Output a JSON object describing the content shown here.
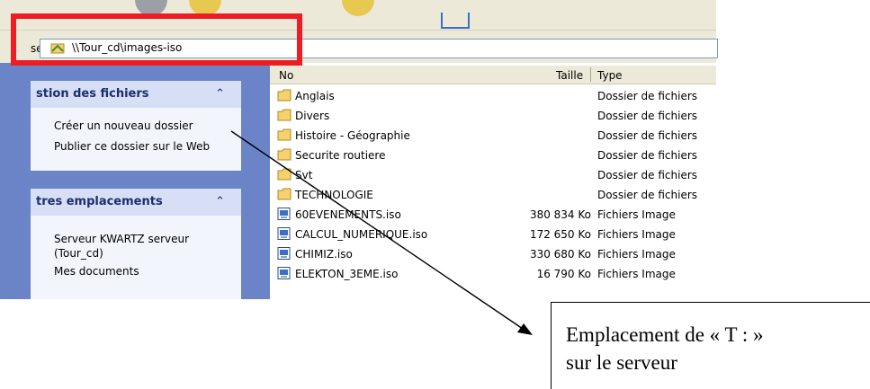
{
  "address_bar": {
    "label": "se",
    "path": "\\\\Tour_cd\\images-iso"
  },
  "sidebar": {
    "file_tasks": {
      "title": "stion des fichiers",
      "items": [
        "Créer un nouveau dossier",
        "Publier ce dossier sur le Web"
      ]
    },
    "other_places": {
      "title": "tres emplacements",
      "items": [
        "Serveur KWARTZ serveur",
        "(Tour_cd)",
        "Mes documents"
      ]
    }
  },
  "file_list": {
    "columns": {
      "name": "No",
      "size": "Taille",
      "type": "Type"
    },
    "rows": [
      {
        "name": "Anglais",
        "size": "",
        "type": "Dossier de fichiers",
        "icon": "folder-icon"
      },
      {
        "name": "Divers",
        "size": "",
        "type": "Dossier de fichiers",
        "icon": "folder-icon"
      },
      {
        "name": "Histoire - Géographie",
        "size": "",
        "type": "Dossier de fichiers",
        "icon": "folder-icon"
      },
      {
        "name": "Securite routiere",
        "size": "",
        "type": "Dossier de fichiers",
        "icon": "folder-icon"
      },
      {
        "name": "Svt",
        "size": "",
        "type": "Dossier de fichiers",
        "icon": "folder-icon"
      },
      {
        "name": "TECHNOLOGIE",
        "size": "",
        "type": "Dossier de fichiers",
        "icon": "folder-icon"
      },
      {
        "name": "60EVENEMENTS.iso",
        "size": "380 834 Ko",
        "type": "Fichiers Image",
        "icon": "iso-file-icon"
      },
      {
        "name": "CALCUL_NUMERIQUE.iso",
        "size": "172 650 Ko",
        "type": "Fichiers Image",
        "icon": "iso-file-icon"
      },
      {
        "name": "CHIMIZ.iso",
        "size": "330 680 Ko",
        "type": "Fichiers Image",
        "icon": "iso-file-icon"
      },
      {
        "name": "ELEKTON_3EME.iso",
        "size": "16 790 Ko",
        "type": "Fichiers Image",
        "icon": "iso-file-icon"
      }
    ]
  },
  "callout": {
    "line1": "Emplacement de « T : »",
    "line2": "sur le serveur"
  },
  "colors": {
    "highlight": "#ee1c25",
    "sidebar_bg": "#6b84c8",
    "panel_head": "#d6dff5",
    "folder": "#f5d26b"
  }
}
